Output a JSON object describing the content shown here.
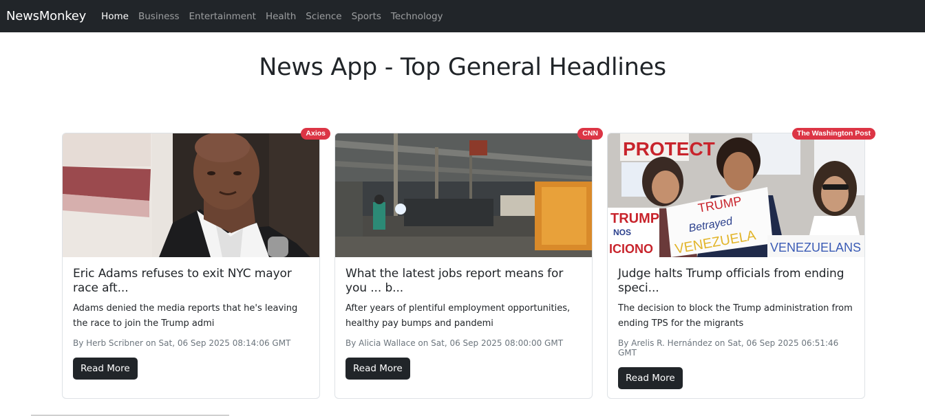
{
  "navbar": {
    "brand": "NewsMonkey",
    "links": [
      {
        "label": "Home",
        "active": true
      },
      {
        "label": "Business",
        "active": false
      },
      {
        "label": "Entertainment",
        "active": false
      },
      {
        "label": "Health",
        "active": false
      },
      {
        "label": "Science",
        "active": false
      },
      {
        "label": "Sports",
        "active": false
      },
      {
        "label": "Technology",
        "active": false
      }
    ]
  },
  "page": {
    "title": "News App - Top General Headlines"
  },
  "colors": {
    "navbar_bg": "#212529",
    "badge_bg": "#dc3545",
    "button_bg": "#212529"
  },
  "articles": [
    {
      "source": "Axios",
      "title": "Eric Adams refuses to exit NYC mayor race aft...",
      "description": "Adams denied the media reports that he's leaving the race to join the Trump admi",
      "meta": "By Herb Scribner on Sat, 06 Sep 2025 08:14:06 GMT",
      "button": "Read More",
      "image": "portrait-photo"
    },
    {
      "source": "CNN",
      "title": "What the latest jobs report means for you ... b...",
      "description": "After years of plentiful employment opportunities, healthy pay bumps and pandemi",
      "meta": "By Alicia Wallace on Sat, 06 Sep 2025 08:00:00 GMT",
      "button": "Read More",
      "image": "factory-photo"
    },
    {
      "source": "The Washington Post",
      "title": "Judge halts Trump officials from ending speci...",
      "description": "The decision to block the Trump administration from ending TPS for the migrants",
      "meta": "By Arelis R. Hernández on Sat, 06 Sep 2025 06:51:46 GMT",
      "button": "Read More",
      "image": "protest-photo"
    }
  ]
}
